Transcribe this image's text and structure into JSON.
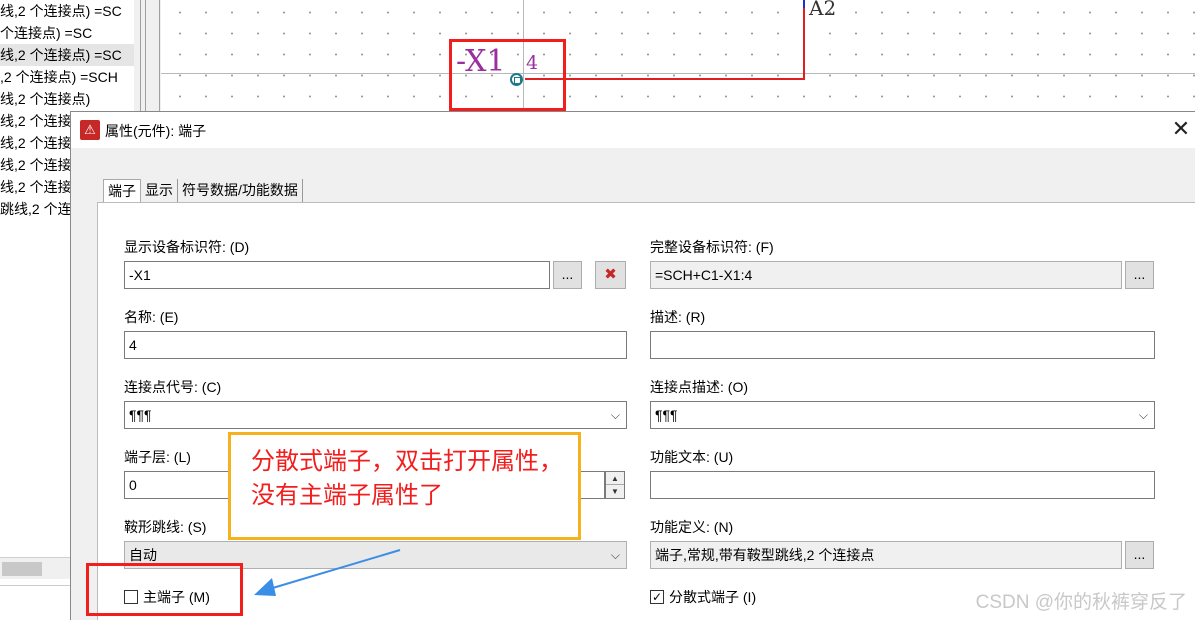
{
  "tree": {
    "items": [
      "线,2 个连接点) =SC",
      "个连接点) =SC",
      "线,2 个连接点) =SC",
      ",2 个连接点) =SCH",
      "线,2 个连接点)",
      "线,2 个连接",
      "线,2 个连接",
      "线,2 个连接",
      "线,2 个连接",
      "跳线,2 个连"
    ],
    "selected_index": 2
  },
  "canvas": {
    "device_tag": "-X1",
    "terminal_number": "4",
    "connection_label": "A2",
    "wire_color": "#e02020",
    "tag_color": "#9b2fa0"
  },
  "dialog": {
    "title": "属性(元件): 端子",
    "tabs": [
      "端子",
      "显示",
      "符号数据/功能数据"
    ],
    "active_tab": 0,
    "fields": {
      "display_tag_label": "显示设备标识符: (D)",
      "display_tag_value": "-X1",
      "full_tag_label": "完整设备标识符: (F)",
      "full_tag_value": "=SCH+C1-X1:4",
      "name_label": "名称: (E)",
      "name_value": "4",
      "desc_label": "描述: (R)",
      "desc_value": "",
      "conn_code_label": "连接点代号: (C)",
      "conn_code_value": "¶¶¶",
      "conn_desc_label": "连接点描述: (O)",
      "conn_desc_value": "¶¶¶",
      "layer_label": "端子层: (L)",
      "layer_value": "0",
      "func_text_label": "功能文本: (U)",
      "func_text_value": "",
      "jumper_label": "鞍形跳线: (S)",
      "jumper_value": "自动",
      "func_def_label": "功能定义: (N)",
      "func_def_value": "端子,常规,带有鞍型跳线,2 个连接点",
      "main_terminal_label": "主端子 (M)",
      "main_terminal_checked": false,
      "distributed_label": "分散式端子 (I)",
      "distributed_checked": true
    },
    "ellipsis": "...",
    "delete_icon": "✖",
    "close_icon": "✕",
    "dropdown_icon": "⌵"
  },
  "annotation": {
    "note_line1": "分散式端子，双击打开属性，",
    "note_line2": "没有主端子属性了",
    "note_border_color": "#f6b21e",
    "highlight_color": "#f21d1d",
    "arrow_color": "#3a8ee6"
  },
  "watermark": "CSDN @你的秋裤穿反了"
}
